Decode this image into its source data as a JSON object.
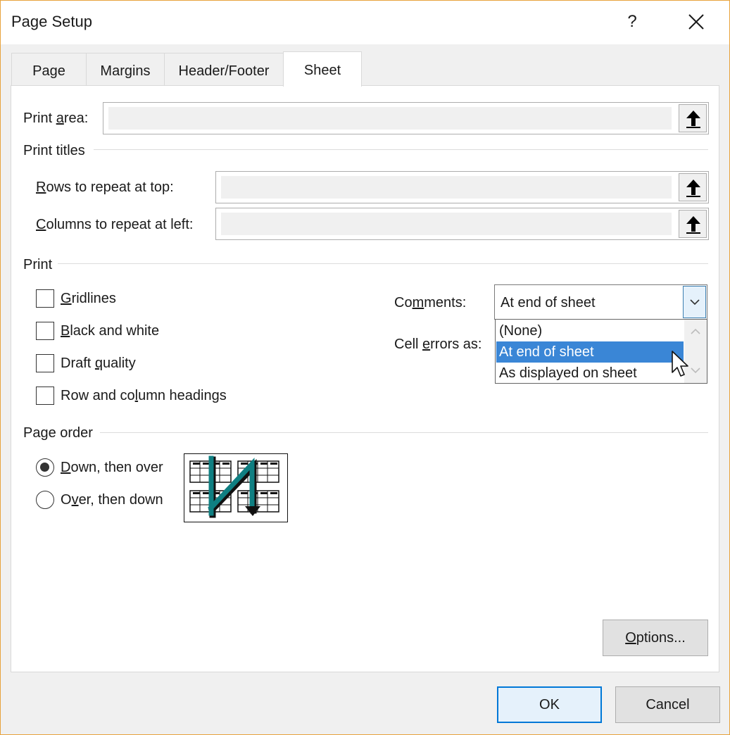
{
  "window": {
    "title": "Page Setup",
    "help_glyph": "?"
  },
  "tabs": [
    {
      "label": "Page"
    },
    {
      "label": "Margins"
    },
    {
      "label": "Header/Footer"
    },
    {
      "label": "Sheet"
    }
  ],
  "print_area": {
    "label_pre": "Print ",
    "label_key": "a",
    "label_post": "rea:",
    "value": ""
  },
  "print_titles": {
    "heading": "Print titles",
    "rows": {
      "label_key": "R",
      "label_post": "ows to repeat at top:",
      "value": ""
    },
    "columns": {
      "label_key": "C",
      "label_post": "olumns to repeat at left:",
      "value": ""
    }
  },
  "print": {
    "heading": "Print",
    "gridlines": {
      "label_key": "G",
      "label_post": "ridlines",
      "checked": false
    },
    "black_white": {
      "label_key": "B",
      "label_post": "lack and white",
      "checked": false
    },
    "draft": {
      "label_pre": "Draft ",
      "label_key": "q",
      "label_post": "uality",
      "checked": false
    },
    "headings": {
      "label_pre": "Row and co",
      "label_key": "l",
      "label_post": "umn headings",
      "checked": false
    },
    "comments": {
      "label_pre": "Co",
      "label_key": "m",
      "label_post": "ments:",
      "value": "At end of sheet"
    },
    "cell_errors": {
      "label_pre": "Cell ",
      "label_key": "e",
      "label_post": "rrors as:"
    },
    "comments_options": [
      "(None)",
      "At end of sheet",
      "As displayed on sheet"
    ],
    "comments_selected_index": 1
  },
  "page_order": {
    "heading": "Page order",
    "down_over": {
      "label_key": "D",
      "label_post": "own, then over",
      "selected": true
    },
    "over_down": {
      "label_pre": "O",
      "label_key": "v",
      "label_post": "er, then down",
      "selected": false
    }
  },
  "buttons": {
    "options": {
      "label_key": "O",
      "label_post": "ptions..."
    },
    "ok": "OK",
    "cancel": "Cancel"
  },
  "colors": {
    "accent": "#0078d7",
    "selection": "#3a86d6",
    "preview_arrow": "#0f7f82",
    "window_border": "#e8a33d"
  }
}
